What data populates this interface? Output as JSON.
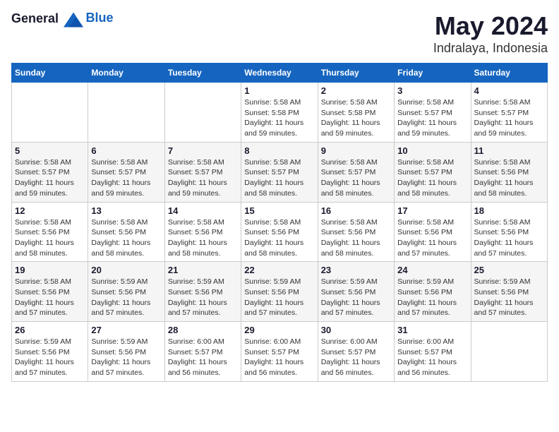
{
  "header": {
    "logo": {
      "text_general": "General",
      "text_blue": "Blue"
    },
    "month": "May 2024",
    "location": "Indralaya, Indonesia"
  },
  "weekdays": [
    "Sunday",
    "Monday",
    "Tuesday",
    "Wednesday",
    "Thursday",
    "Friday",
    "Saturday"
  ],
  "weeks": [
    [
      {
        "day": "",
        "info": ""
      },
      {
        "day": "",
        "info": ""
      },
      {
        "day": "",
        "info": ""
      },
      {
        "day": "1",
        "info": "Sunrise: 5:58 AM\nSunset: 5:58 PM\nDaylight: 11 hours\nand 59 minutes."
      },
      {
        "day": "2",
        "info": "Sunrise: 5:58 AM\nSunset: 5:58 PM\nDaylight: 11 hours\nand 59 minutes."
      },
      {
        "day": "3",
        "info": "Sunrise: 5:58 AM\nSunset: 5:57 PM\nDaylight: 11 hours\nand 59 minutes."
      },
      {
        "day": "4",
        "info": "Sunrise: 5:58 AM\nSunset: 5:57 PM\nDaylight: 11 hours\nand 59 minutes."
      }
    ],
    [
      {
        "day": "5",
        "info": "Sunrise: 5:58 AM\nSunset: 5:57 PM\nDaylight: 11 hours\nand 59 minutes."
      },
      {
        "day": "6",
        "info": "Sunrise: 5:58 AM\nSunset: 5:57 PM\nDaylight: 11 hours\nand 59 minutes."
      },
      {
        "day": "7",
        "info": "Sunrise: 5:58 AM\nSunset: 5:57 PM\nDaylight: 11 hours\nand 59 minutes."
      },
      {
        "day": "8",
        "info": "Sunrise: 5:58 AM\nSunset: 5:57 PM\nDaylight: 11 hours\nand 58 minutes."
      },
      {
        "day": "9",
        "info": "Sunrise: 5:58 AM\nSunset: 5:57 PM\nDaylight: 11 hours\nand 58 minutes."
      },
      {
        "day": "10",
        "info": "Sunrise: 5:58 AM\nSunset: 5:57 PM\nDaylight: 11 hours\nand 58 minutes."
      },
      {
        "day": "11",
        "info": "Sunrise: 5:58 AM\nSunset: 5:56 PM\nDaylight: 11 hours\nand 58 minutes."
      }
    ],
    [
      {
        "day": "12",
        "info": "Sunrise: 5:58 AM\nSunset: 5:56 PM\nDaylight: 11 hours\nand 58 minutes."
      },
      {
        "day": "13",
        "info": "Sunrise: 5:58 AM\nSunset: 5:56 PM\nDaylight: 11 hours\nand 58 minutes."
      },
      {
        "day": "14",
        "info": "Sunrise: 5:58 AM\nSunset: 5:56 PM\nDaylight: 11 hours\nand 58 minutes."
      },
      {
        "day": "15",
        "info": "Sunrise: 5:58 AM\nSunset: 5:56 PM\nDaylight: 11 hours\nand 58 minutes."
      },
      {
        "day": "16",
        "info": "Sunrise: 5:58 AM\nSunset: 5:56 PM\nDaylight: 11 hours\nand 58 minutes."
      },
      {
        "day": "17",
        "info": "Sunrise: 5:58 AM\nSunset: 5:56 PM\nDaylight: 11 hours\nand 57 minutes."
      },
      {
        "day": "18",
        "info": "Sunrise: 5:58 AM\nSunset: 5:56 PM\nDaylight: 11 hours\nand 57 minutes."
      }
    ],
    [
      {
        "day": "19",
        "info": "Sunrise: 5:58 AM\nSunset: 5:56 PM\nDaylight: 11 hours\nand 57 minutes."
      },
      {
        "day": "20",
        "info": "Sunrise: 5:59 AM\nSunset: 5:56 PM\nDaylight: 11 hours\nand 57 minutes."
      },
      {
        "day": "21",
        "info": "Sunrise: 5:59 AM\nSunset: 5:56 PM\nDaylight: 11 hours\nand 57 minutes."
      },
      {
        "day": "22",
        "info": "Sunrise: 5:59 AM\nSunset: 5:56 PM\nDaylight: 11 hours\nand 57 minutes."
      },
      {
        "day": "23",
        "info": "Sunrise: 5:59 AM\nSunset: 5:56 PM\nDaylight: 11 hours\nand 57 minutes."
      },
      {
        "day": "24",
        "info": "Sunrise: 5:59 AM\nSunset: 5:56 PM\nDaylight: 11 hours\nand 57 minutes."
      },
      {
        "day": "25",
        "info": "Sunrise: 5:59 AM\nSunset: 5:56 PM\nDaylight: 11 hours\nand 57 minutes."
      }
    ],
    [
      {
        "day": "26",
        "info": "Sunrise: 5:59 AM\nSunset: 5:56 PM\nDaylight: 11 hours\nand 57 minutes."
      },
      {
        "day": "27",
        "info": "Sunrise: 5:59 AM\nSunset: 5:56 PM\nDaylight: 11 hours\nand 57 minutes."
      },
      {
        "day": "28",
        "info": "Sunrise: 6:00 AM\nSunset: 5:57 PM\nDaylight: 11 hours\nand 56 minutes."
      },
      {
        "day": "29",
        "info": "Sunrise: 6:00 AM\nSunset: 5:57 PM\nDaylight: 11 hours\nand 56 minutes."
      },
      {
        "day": "30",
        "info": "Sunrise: 6:00 AM\nSunset: 5:57 PM\nDaylight: 11 hours\nand 56 minutes."
      },
      {
        "day": "31",
        "info": "Sunrise: 6:00 AM\nSunset: 5:57 PM\nDaylight: 11 hours\nand 56 minutes."
      },
      {
        "day": "",
        "info": ""
      }
    ]
  ]
}
